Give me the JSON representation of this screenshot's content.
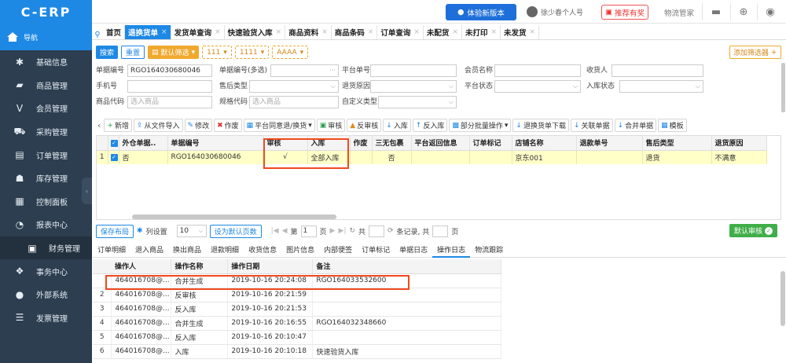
{
  "app": {
    "logo": "C-ERP",
    "nav_label": "导航"
  },
  "sidebar": {
    "items": [
      {
        "label": "基础信息",
        "icon": "gear-icon"
      },
      {
        "label": "商品管理",
        "icon": "box-icon"
      },
      {
        "label": "会员管理",
        "icon": "v-icon"
      },
      {
        "label": "采购管理",
        "icon": "cart-icon"
      },
      {
        "label": "订单管理",
        "icon": "clipboard-icon"
      },
      {
        "label": "库存管理",
        "icon": "warehouse-icon"
      },
      {
        "label": "控制面板",
        "icon": "dashboard-icon"
      },
      {
        "label": "报表中心",
        "icon": "pie-chart-icon"
      },
      {
        "label": "财务管理",
        "icon": "finance-icon"
      },
      {
        "label": "事务中心",
        "icon": "transaction-icon"
      },
      {
        "label": "外部系统",
        "icon": "external-icon"
      },
      {
        "label": "发票管理",
        "icon": "invoice-icon"
      }
    ]
  },
  "topbar": {
    "experience_button": "体验新版本",
    "user_name": "徐少春个人号",
    "reward": "推荐有奖",
    "manager": "物流管家"
  },
  "tabs": [
    {
      "label": "首页",
      "closable": false
    },
    {
      "label": "退换货单",
      "closable": true,
      "active": true
    },
    {
      "label": "发货单查询",
      "closable": true
    },
    {
      "label": "快速验货入库",
      "closable": true
    },
    {
      "label": "商品资料",
      "closable": true
    },
    {
      "label": "商品条码",
      "closable": true
    },
    {
      "label": "订单查询",
      "closable": true
    },
    {
      "label": "未配货",
      "closable": true
    },
    {
      "label": "未打印",
      "closable": true
    },
    {
      "label": "未发货",
      "closable": true
    }
  ],
  "searchbar": {
    "search": "搜索",
    "reset": "重置",
    "default_filter": "默认筛选",
    "chip1": "111",
    "chip2": "1111",
    "chip3": "AAAA",
    "add_filter": "添加筛选器"
  },
  "form": {
    "order_no_label": "单据编号",
    "order_no_value": "RGO164030680046",
    "order_no_multi_label": "单据编号(多选)",
    "platform_no_label": "平台单号",
    "member_label": "会员名称",
    "receiver_label": "收货人",
    "phone_label": "手机号",
    "after_sale_type_label": "售后类型",
    "return_reason_label": "退货原因",
    "platform_status_label": "平台状态",
    "stock_status_label": "入库状态",
    "product_code_label": "商品代码",
    "product_code_placeholder": "选入商品",
    "spec_code_label": "规格代码",
    "spec_code_placeholder": "选入商品",
    "custom_type_label": "自定义类型"
  },
  "actions": [
    {
      "label": "新增",
      "icon": "plus-icon"
    },
    {
      "label": "从文件导入",
      "icon": "import-icon"
    },
    {
      "label": "修改",
      "icon": "edit-icon"
    },
    {
      "label": "作废",
      "icon": "void-icon"
    },
    {
      "label": "平台同意退/换货",
      "icon": "agree-icon",
      "dropdown": true
    },
    {
      "label": "审核",
      "icon": "approve-icon"
    },
    {
      "label": "反审核",
      "icon": "unapprove-icon"
    },
    {
      "label": "入库",
      "icon": "stock-in-icon"
    },
    {
      "label": "反入库",
      "icon": "reverse-stock-in-icon"
    },
    {
      "label": "部分批量操作",
      "icon": "batch-icon",
      "dropdown": true
    },
    {
      "label": "退换货单下载",
      "icon": "download-icon"
    },
    {
      "label": "关联单据",
      "icon": "link-icon"
    },
    {
      "label": "合并单据",
      "icon": "merge-icon"
    },
    {
      "label": "模板",
      "icon": "template-icon"
    }
  ],
  "grid": {
    "headers": [
      "外仓单据..",
      "单据编号",
      "审核",
      "入库",
      "作废",
      "三无包裹",
      "平台返回信息",
      "订单标记",
      "店铺名称",
      "退款单号",
      "售后类型",
      "退货原因"
    ],
    "rows": [
      {
        "index": "1",
        "ext": "否",
        "order_no": "RGO164030680046",
        "approved": "√",
        "stock": "全部入库",
        "void": "",
        "no_pkg": "否",
        "platform_msg": "",
        "mark": "",
        "shop": "京东001",
        "refund_no": "",
        "after_sale": "退货",
        "reason": "不满意"
      }
    ]
  },
  "pager": {
    "save_layout": "保存布局",
    "column_settings": "列设置",
    "page_size": "10",
    "set_default": "设为默认页数",
    "page_label_pre": "第",
    "page_value": "1",
    "page_label_post": "页",
    "total_pre": "共",
    "records_label": "条记录, 共",
    "pages_post": "页",
    "approve_default": "默认审核"
  },
  "bottom_tabs": [
    "订单明细",
    "退入商品",
    "换出商品",
    "退款明细",
    "收货信息",
    "图片信息",
    "内部便签",
    "订单标记",
    "单据日志",
    "操作日志",
    "物流跟踪"
  ],
  "bottom_active": "操作日志",
  "log": {
    "headers": [
      "操作人",
      "操作名称",
      "操作日期",
      "备注"
    ],
    "rows": [
      {
        "index": "",
        "user": "464016708@...",
        "action": "合并生成",
        "date": "2019-10-16 20:24:08",
        "note": "RGO164033532600"
      },
      {
        "index": "2",
        "user": "464016708@...",
        "action": "反审核",
        "date": "2019-10-16 20:21:59",
        "note": ""
      },
      {
        "index": "3",
        "user": "464016708@...",
        "action": "反入库",
        "date": "2019-10-16 20:21:53",
        "note": ""
      },
      {
        "index": "4",
        "user": "464016708@...",
        "action": "合并生成",
        "date": "2019-10-16 20:16:55",
        "note": "RGO164032348660"
      },
      {
        "index": "5",
        "user": "464016708@...",
        "action": "反入库",
        "date": "2019-10-16 20:10:47",
        "note": ""
      },
      {
        "index": "6",
        "user": "464016708@...",
        "action": "入库",
        "date": "2019-10-16 20:10:18",
        "note": "快速验货入库"
      }
    ]
  },
  "colors": {
    "primary": "#1e88e5",
    "sidebar": "#2c3e50",
    "highlight": "#f04a1f",
    "success": "#3fae49",
    "row_selected": "#ffffc8"
  }
}
